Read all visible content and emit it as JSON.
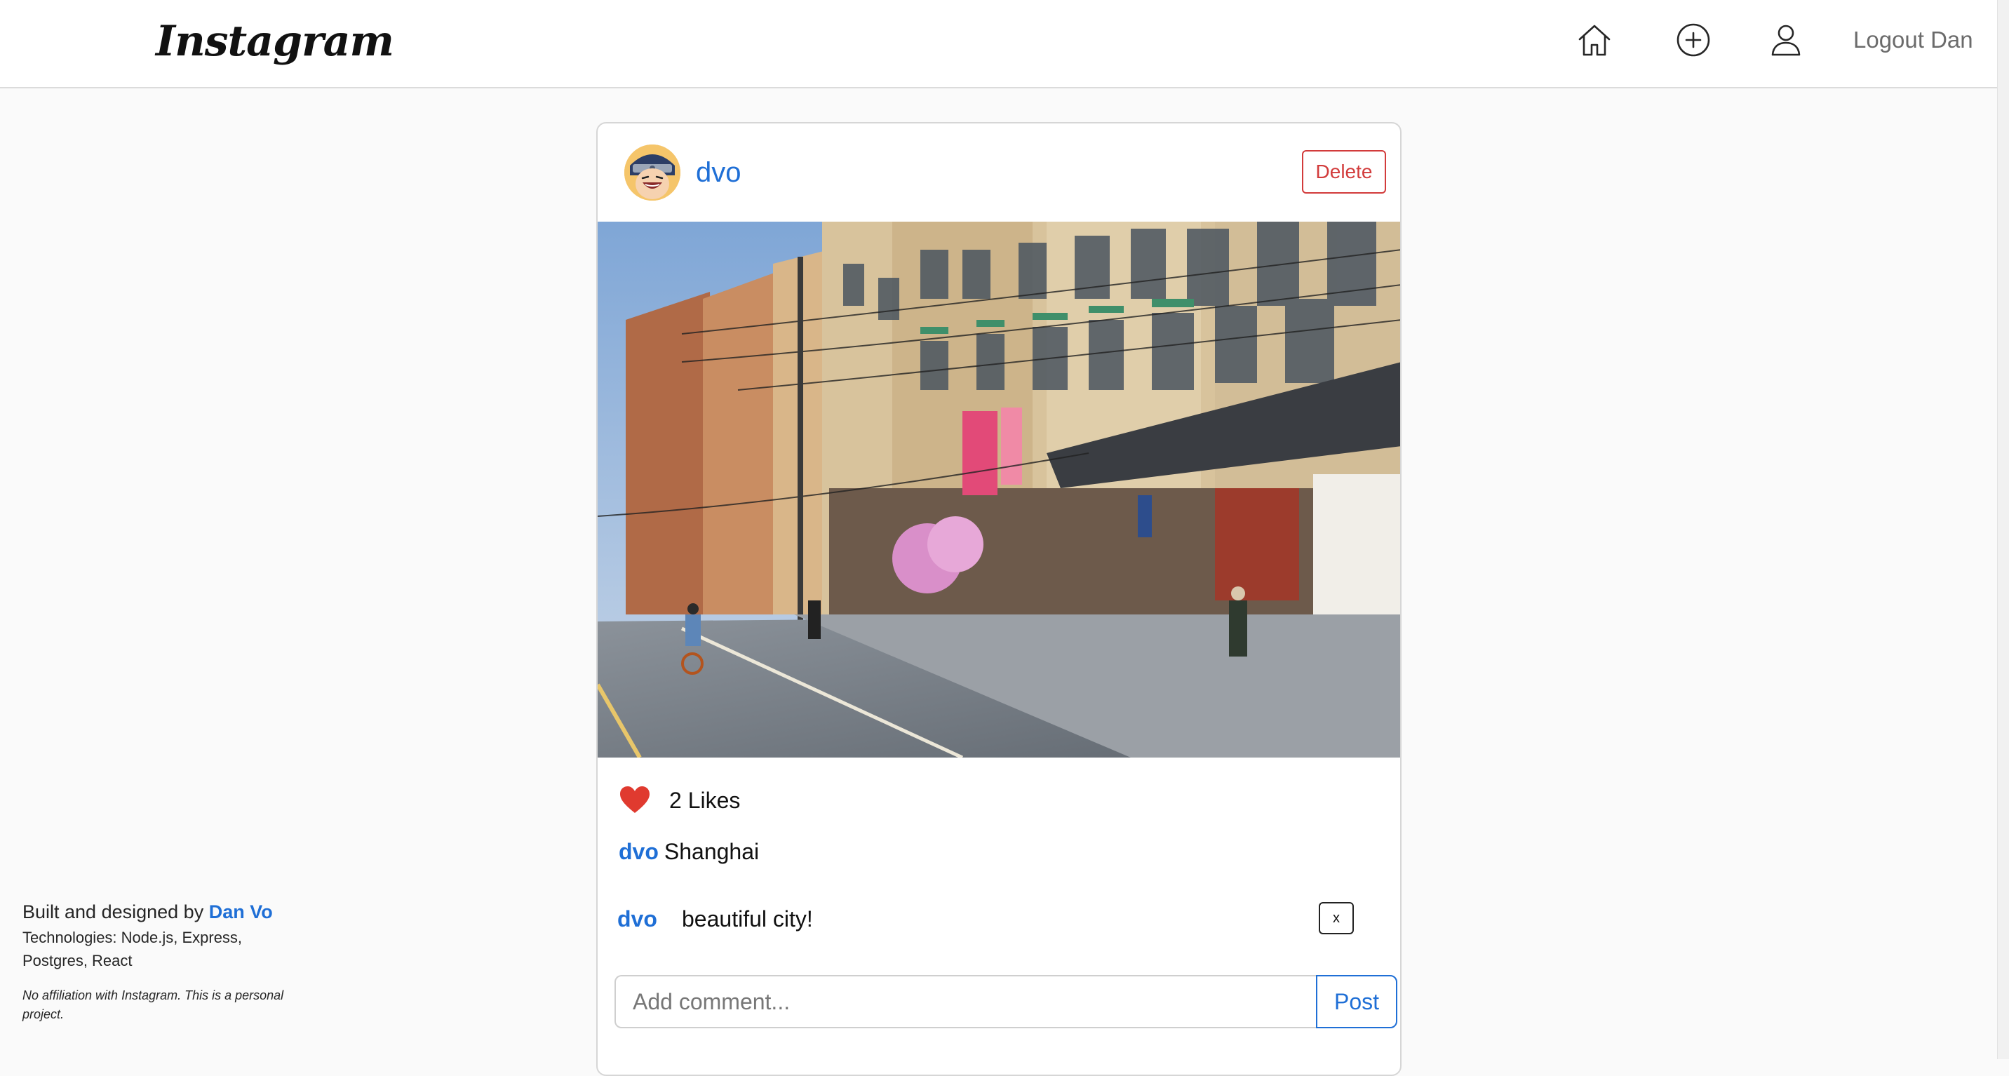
{
  "navbar": {
    "logo_text": "Instagram",
    "icons": {
      "home": "home-icon",
      "add_post": "plus-circle-icon",
      "profile": "user-icon"
    },
    "logout_label": "Logout Dan"
  },
  "post": {
    "username": "dvo",
    "delete_label": "Delete",
    "image_alt": "Shanghai street",
    "likes_label": "2 Likes",
    "caption": {
      "user": "dvo",
      "text": "Shanghai"
    },
    "comments": [
      {
        "user": "dvo",
        "text": "beautiful city!",
        "delete_label": "x"
      }
    ],
    "comment_form": {
      "placeholder": "Add comment...",
      "value": "",
      "submit_label": "Post"
    }
  },
  "credits": {
    "prefix": "Built and designed by",
    "author": "Dan Vo",
    "technologies": "Technologies: Node.js, Express, Postgres, React",
    "disclaimer": "No affiliation with Instagram. This is a personal project."
  },
  "colors": {
    "link_blue": "#1f6fd6",
    "danger_red": "#d23b3b",
    "like_red": "#e03a2f",
    "background": "#fafafa"
  }
}
